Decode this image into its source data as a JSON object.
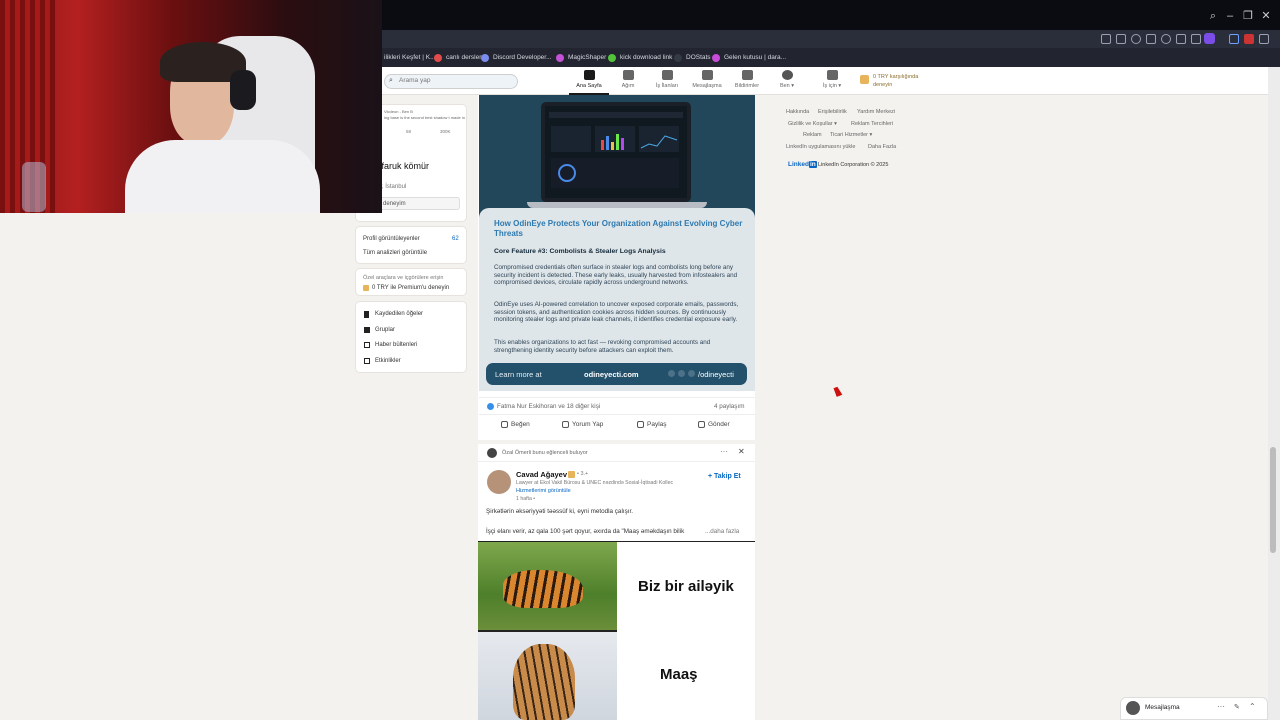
{
  "browser": {
    "bookmarks": [
      {
        "label": "ilikleri Keşfet | K...",
        "color": "#5d8de0"
      },
      {
        "label": "canlı dersler",
        "color": "#e14b4b"
      },
      {
        "label": "Discord Developer...",
        "color": "#7b8cf0"
      },
      {
        "label": "MagicShaper",
        "color": "#c352d6"
      },
      {
        "label": "kick download link",
        "color": "#53c33a"
      },
      {
        "label": "DOStats",
        "color": "#333a44"
      },
      {
        "label": "Gelen kutusu | dara...",
        "color": "#c94bd9"
      }
    ]
  },
  "linkedin": {
    "search_placeholder": "Arama yap",
    "nav": [
      {
        "label": "Ana Sayfa",
        "icon": "home-icon"
      },
      {
        "label": "Ağım",
        "icon": "network-icon"
      },
      {
        "label": "İş İlanları",
        "icon": "briefcase-icon"
      },
      {
        "label": "Mesajlaşma",
        "icon": "message-icon"
      },
      {
        "label": "Bildirimler",
        "icon": "bell-icon"
      },
      {
        "label": "Ben ▾",
        "icon": "avatar-icon"
      },
      {
        "label": "İş için ▾",
        "icon": "grid-icon"
      }
    ],
    "premium_nav": {
      "line1": "0 TRY karşılığında",
      "line2": "deneyin"
    },
    "profile": {
      "mini_text": "Vlcdeon - Ben B",
      "mini_sub": "ing base is the second best shadow t made in",
      "mini_stat1": "58",
      "mini_stat2": "300K",
      "name": "r faruk kömür",
      "location": "ay, İstanbul",
      "button": "deneyim"
    },
    "stats": {
      "viewers_label": "Profil görüntüleyenler",
      "viewers_value": "62",
      "analytics": "Tüm analizleri görüntüle"
    },
    "premium_card": {
      "text": "Özel araçlara ve içgörülere erişin",
      "cta": "0 TRY ile Premium'u deneyin"
    },
    "shortcuts": [
      "Kaydedilen öğeler",
      "Gruplar",
      "Haber bültenleri",
      "Etkinlikler"
    ],
    "ad": {
      "title": "How OdinEye Protects Your Organization Against Evolving Cyber Threats",
      "subtitle": "Core Feature #3: Combolists & Stealer Logs Analysis",
      "para1": "Compromised credentials often surface in stealer logs and combolists long before any security incident is detected. These early leaks, usually harvested from infostealers and compromised devices, circulate rapidly across underground networks.",
      "para2": "OdinEye uses AI-powered correlation to uncover exposed corporate emails, passwords, session tokens, and authentication cookies across hidden sources. By continuously monitoring stealer logs and private leak channels, it identifies credential exposure early.",
      "para3": "This enables organizations to act fast — revoking compromised accounts and strengthening identity security before attackers can exploit them.",
      "learn_more": "Learn more at",
      "site": "odineyecti.com",
      "handle": "/odineyecti"
    },
    "reactions": {
      "text": "Fatma Nur Eskihoran ve 18 diğer kişi",
      "shares": "4 paylaşım"
    },
    "actions": [
      "Beğen",
      "Yorum Yap",
      "Paylaş",
      "Gönder"
    ],
    "post2": {
      "context": "Özal Ömerli bunu eğlenceli buluyor",
      "author": "Cavad Ağayev",
      "degree": "• 3.+",
      "headline": "Lawyer at Ekol Vakil Bürosu & UNEC nəzdində Sosial-İqtisadi Kollec",
      "services": "Hizmetlerimi görüntüle",
      "time": "1 hafta • ",
      "follow": "+ Takip Et",
      "text1": "Şirkətlərin əksəriyyəti təəssüf ki, eyni metodla çalışır.",
      "text2": "İşçi elanı verir, az qala 100 şərt qoyur, əxırda da \"Maaş əməkdaşın bilik",
      "more": "...daha fazla",
      "meme1": "Biz bir ailəyik",
      "meme2": "Maaş"
    },
    "footer_links": [
      [
        "Hakkında",
        "Erişilebilirlik",
        "Yardım Merkezi"
      ],
      [
        "Gizlilik ve Koşullar ▾",
        "Reklam Tercihleri"
      ],
      [
        "Reklam",
        "Ticari Hizmetler ▾"
      ],
      [
        "LinkedIn uygulamasını yükle",
        "Daha Fazla"
      ]
    ],
    "brand": "Linked",
    "brand_in": "in",
    "copyright": "LinkedIn Corporation © 2025",
    "chat": "Mesajlaşma"
  }
}
